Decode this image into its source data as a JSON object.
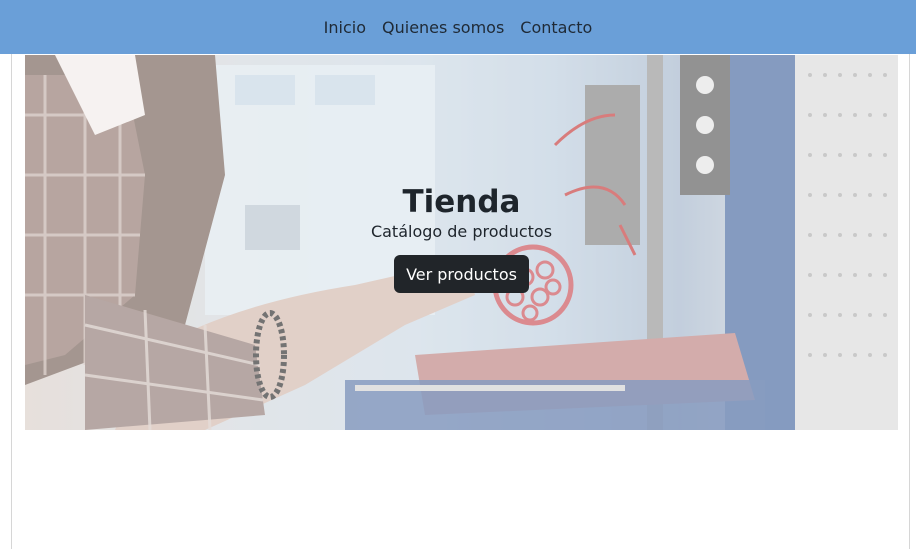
{
  "nav": {
    "items": [
      {
        "label": "Inicio"
      },
      {
        "label": "Quienes somos"
      },
      {
        "label": "Contacto"
      }
    ]
  },
  "hero": {
    "title": "Tienda",
    "subtitle": "Catálogo de productos",
    "button_label": "Ver productos",
    "image_subject": "person holding red 3D-printed lattice sphere next to a 3D printer"
  },
  "colors": {
    "navbar": "#6a9fd8",
    "button": "#212529"
  }
}
